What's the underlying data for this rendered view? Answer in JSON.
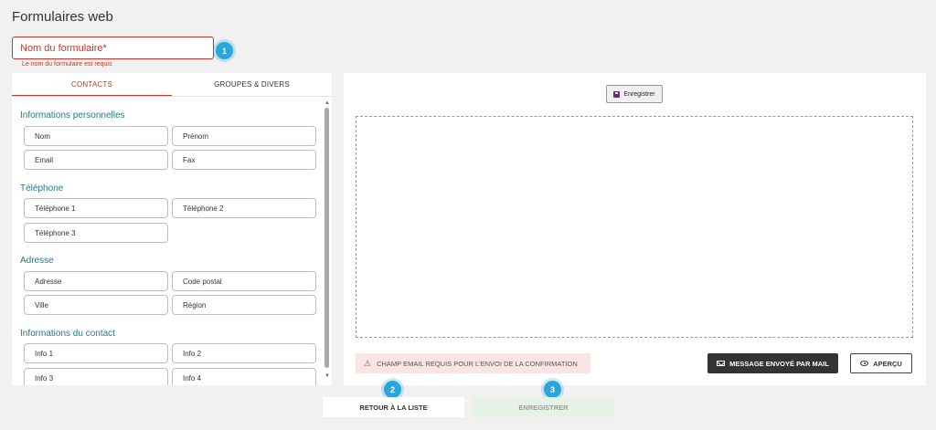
{
  "page": {
    "title": "Formulaires web"
  },
  "form_name": {
    "placeholder": "Nom du formulaire*",
    "error": "Le nom du formulaire est requis"
  },
  "steps": [
    "1",
    "2",
    "3"
  ],
  "tabs": [
    {
      "label": "CONTACTS",
      "active": true
    },
    {
      "label": "GROUPES & DIVERS",
      "active": false
    }
  ],
  "sections": [
    {
      "title": "Informations personnelles",
      "fields": [
        "Nom",
        "Prénom",
        "Email",
        "Fax"
      ]
    },
    {
      "title": "Téléphone",
      "fields": [
        "Téléphone 1",
        "Téléphone 2",
        "Téléphone 3"
      ]
    },
    {
      "title": "Adresse",
      "fields": [
        "Adresse",
        "Code postal",
        "Ville",
        "Région"
      ]
    },
    {
      "title": "Informations du contact",
      "fields": [
        "Info 1",
        "Info 2",
        "Info 3",
        "Info 4"
      ]
    }
  ],
  "editor": {
    "save_label": "Enregistrer",
    "warning": "CHAMP EMAIL REQUIS POUR L'ENVOI DE LA CONFIRMATION",
    "mail_label": "MESSAGE ENVOYÉ PAR MAIL",
    "preview_label": "APERÇU"
  },
  "footer": {
    "back_label": "RETOUR À LA LISTE",
    "save_label": "ENREGISTRER"
  },
  "colors": {
    "error": "#c0392b",
    "section_title": "#1f7b87",
    "badge": "#2aa6d9"
  }
}
